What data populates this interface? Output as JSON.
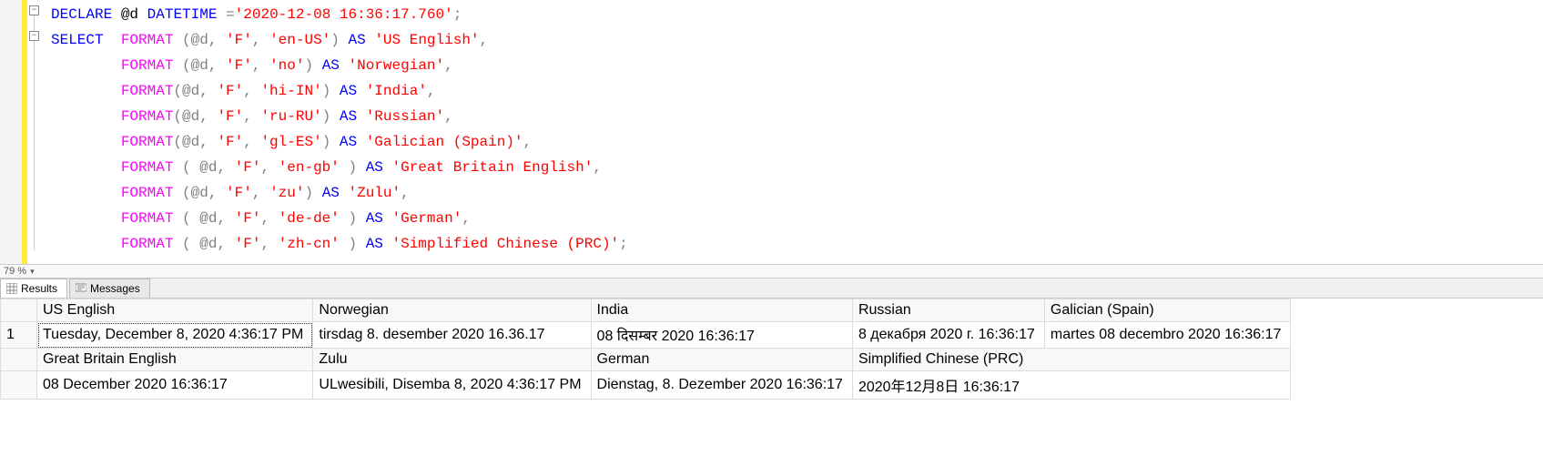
{
  "zoom": "79 %",
  "code": {
    "line1": {
      "declare": "DECLARE",
      "var": "@d",
      "type": "DATETIME",
      "eq": "=",
      "str": "'2020-12-08 16:36:17.760'",
      "semi": ";"
    },
    "select": "SELECT",
    "format": "FORMAT",
    "as": "AS",
    "args": {
      "f1": {
        "p": "(@d, ",
        "fmt": "'F'",
        "c": ", ",
        "loc": "'en-US'",
        "close": ")",
        "alias": "'US English'",
        "end": ","
      },
      "f2": {
        "p": "(@d, ",
        "fmt": "'F'",
        "c": ", ",
        "loc": "'no'",
        "close": ")",
        "alias": "'Norwegian'",
        "end": ","
      },
      "f3": {
        "p": "(@d, ",
        "fmt": "'F'",
        "c": ", ",
        "loc": "'hi-IN'",
        "close": ")",
        "alias": "'India'",
        "end": ","
      },
      "f4": {
        "p": "(@d, ",
        "fmt": "'F'",
        "c": ", ",
        "loc": "'ru-RU'",
        "close": ")",
        "alias": "'Russian'",
        "end": ","
      },
      "f5": {
        "p": "(@d, ",
        "fmt": "'F'",
        "c": ", ",
        "loc": "'gl-ES'",
        "close": ")",
        "alias": "'Galician (Spain)'",
        "end": ","
      },
      "f6": {
        "p": "( @d, ",
        "fmt": "'F'",
        "c": ", ",
        "loc": "'en-gb'",
        "close": " )",
        "alias": "'Great Britain English'",
        "end": ","
      },
      "f7": {
        "p": "(@d, ",
        "fmt": "'F'",
        "c": ", ",
        "loc": "'zu'",
        "close": ")",
        "alias": "'Zulu'",
        "end": ","
      },
      "f8": {
        "p": "( @d, ",
        "fmt": "'F'",
        "c": ", ",
        "loc": "'de-de'",
        "close": " )",
        "alias": "'German'",
        "end": ","
      },
      "f9": {
        "p": "( @d, ",
        "fmt": "'F'",
        "c": ", ",
        "loc": "'zh-cn'",
        "close": " )",
        "alias": "'Simplified Chinese (PRC)'",
        "end": ";"
      }
    }
  },
  "tabs": {
    "results": "Results",
    "messages": "Messages"
  },
  "results": {
    "rownum": "1",
    "row1": {
      "h1": "US English",
      "v1": "Tuesday, December 8, 2020 4:36:17 PM",
      "h2": "Norwegian",
      "v2": "tirsdag 8. desember 2020 16.36.17",
      "h3": "India",
      "v3": "08 दिसम्बर 2020 16:36:17",
      "h4": "Russian",
      "v4": "8 декабря 2020 г. 16:36:17",
      "h5": "Galician (Spain)",
      "v5": "martes 08 decembro 2020 16:36:17"
    },
    "row2": {
      "h1": "Great Britain English",
      "v1": "08 December 2020 16:36:17",
      "h2": "Zulu",
      "v2": "ULwesibili, Disemba 8, 2020 4:36:17 PM",
      "h3": "German",
      "v3": "Dienstag, 8. Dezember 2020 16:36:17",
      "h4": "Simplified Chinese (PRC)",
      "v4": "2020年12月8日 16:36:17"
    }
  }
}
